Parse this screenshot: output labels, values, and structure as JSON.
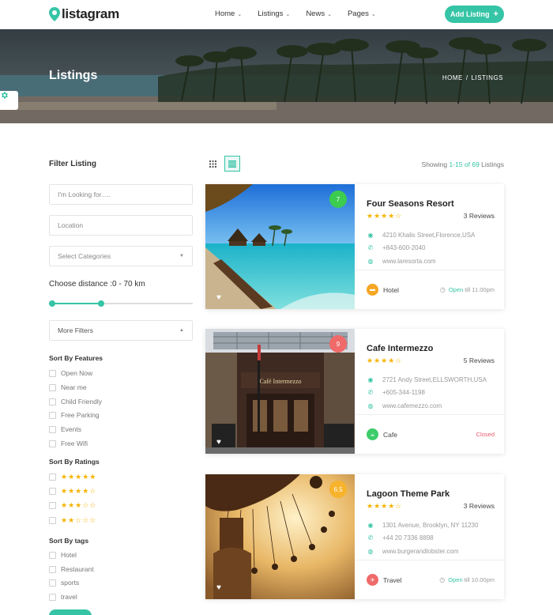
{
  "header": {
    "logo": "listagram",
    "nav": [
      {
        "label": "Home"
      },
      {
        "label": "Listings"
      },
      {
        "label": "News"
      },
      {
        "label": "Pages"
      }
    ],
    "add_listing_label": "Add Listing",
    "add_listing_icon": "plus-icon",
    "accent_color": "#35c4a6"
  },
  "hero": {
    "title": "Listings",
    "breadcrumb": {
      "home": "HOME",
      "separator": "/",
      "current": "LISTINGS"
    }
  },
  "sidebar": {
    "title": "Filter Listing",
    "search_placeholder": "I'm Looking for.....",
    "location_placeholder": "Location",
    "category_placeholder": "Select Categories",
    "distance_label": "Choose distance :0 - 70 km",
    "distance_range_km": [
      0,
      70
    ],
    "more_filters_label": "More Filters",
    "features_title": "Sort By Features",
    "features": [
      "Open Now",
      "Near me",
      "Child Friendly",
      "Free Parking",
      "Events",
      "Free Wifi"
    ],
    "ratings_title": "Sort By Ratings",
    "ratings": [
      "★★★★★",
      "★★★★☆",
      "★★★☆☆",
      "★★☆☆☆"
    ],
    "tags_title": "Sort By tags",
    "tags": [
      "Hotel",
      "Restaurant",
      "sports",
      "travel"
    ]
  },
  "toolbar": {
    "showing_prefix": "Showing",
    "showing_range": "1-15 of 69",
    "showing_suffix": "Listings",
    "grid_icon": "grid-view-icon",
    "list_icon": "list-view-icon"
  },
  "listings": [
    {
      "name": "Four Seasons Resort",
      "rating": "7",
      "rating_color": "#3ccc4f",
      "stars": "★★★★☆",
      "reviews": "3 Reviews",
      "address": "4210 Khalis Street,Florence,USA",
      "phone": "+843-600-2040",
      "website": "www.laresorta.com",
      "category": "Hotel",
      "category_color": "#f5a623",
      "status_open": "Open",
      "status_rest": "till 11.00pm"
    },
    {
      "name": "Cafe Intermezzo",
      "rating": "9",
      "rating_color": "#f06a6a",
      "stars": "★★★★☆",
      "reviews": "5 Reviews",
      "address": "2721 Andy Street,ELLSWORTH,USA",
      "phone": "+605-344-1198",
      "website": "www.cafemezzo.com",
      "category": "Cafe",
      "category_color": "#3ccc6a",
      "status_closed": "Closed"
    },
    {
      "name": "Lagoon Theme Park",
      "rating": "6.5",
      "rating_color": "#f7b32b",
      "stars": "★★★★☆",
      "reviews": "3 Reviews",
      "address": "1301 Avenue, Brooklyn, NY 11230",
      "phone": "+44 20 7336 8898",
      "website": "www.burgerandlobster.com",
      "category": "Travel",
      "category_color": "#f06a6a",
      "status_open": "Open",
      "status_rest": "till 10.00pm"
    }
  ]
}
